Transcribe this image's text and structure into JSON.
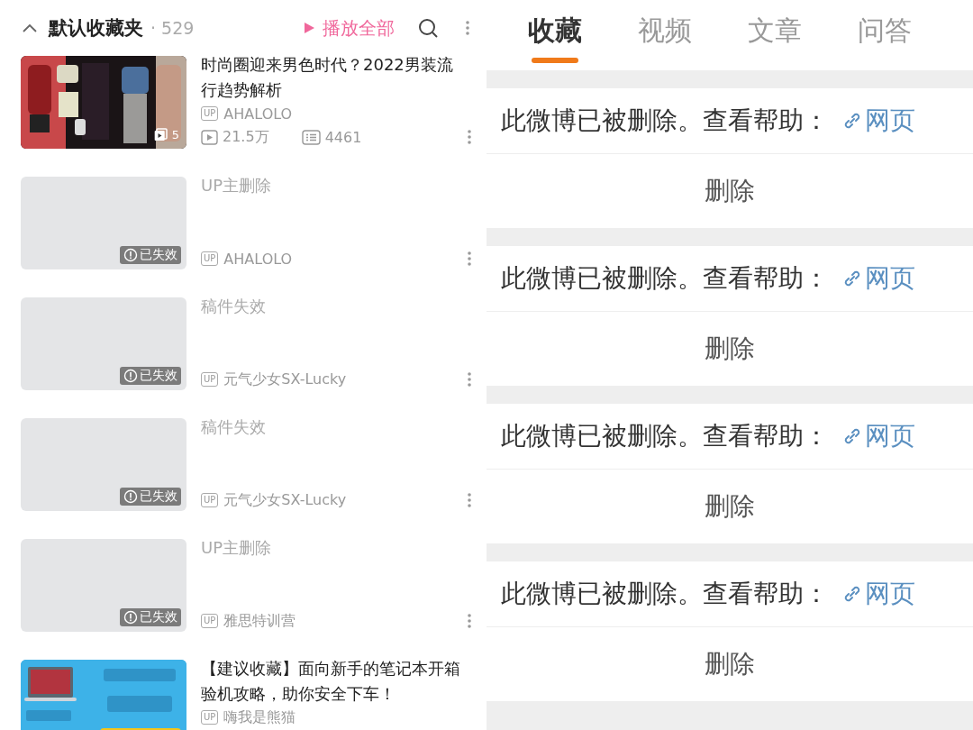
{
  "collection": {
    "title": "默认收藏夹",
    "count": "· 529",
    "play_all": "播放全部"
  },
  "videos": [
    {
      "kind": "valid",
      "title": "时尚圈迎来男色时代？2022男装流行趋势解析",
      "up_label": "UP",
      "uploader": "AHALOLO",
      "episodes": "5",
      "views": "21.5万",
      "comments": "4461"
    },
    {
      "kind": "invalid",
      "title": "UP主删除",
      "up_label": "UP",
      "uploader": "AHALOLO",
      "badge": "已失效"
    },
    {
      "kind": "invalid",
      "title": "稿件失效",
      "up_label": "UP",
      "uploader": "元气少女SX-Lucky",
      "badge": "已失效"
    },
    {
      "kind": "invalid",
      "title": "稿件失效",
      "up_label": "UP",
      "uploader": "元气少女SX-Lucky",
      "badge": "已失效"
    },
    {
      "kind": "invalid",
      "title": "UP主删除",
      "up_label": "UP",
      "uploader": "雅思特训营",
      "badge": "已失效"
    },
    {
      "kind": "valid",
      "title": "【建议收藏】面向新手的笔记本开箱验机攻略，助你安全下车！",
      "up_label": "UP",
      "uploader": "嗨我是熊猫"
    }
  ],
  "tabs": [
    {
      "label": "收藏",
      "selected": true
    },
    {
      "label": "视频",
      "selected": false
    },
    {
      "label": "文章",
      "selected": false
    },
    {
      "label": "问答",
      "selected": false
    }
  ],
  "posts": [
    {
      "message": "此微博已被删除。查看帮助：",
      "link": "网页",
      "action": "删除"
    },
    {
      "message": "此微博已被删除。查看帮助：",
      "link": "网页",
      "action": "删除"
    },
    {
      "message": "此微博已被删除。查看帮助：",
      "link": "网页",
      "action": "删除"
    },
    {
      "message": "此微博已被删除。查看帮助：",
      "link": "网页",
      "action": "删除"
    }
  ]
}
